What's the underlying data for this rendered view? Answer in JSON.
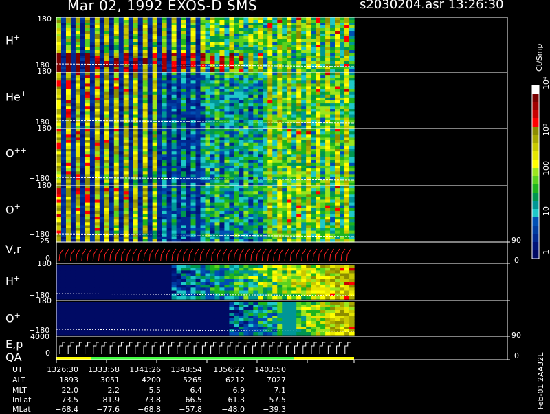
{
  "header": {
    "title": "Mar 02, 1992   EXOS-D SMS",
    "file_time": "s2030204.asr  13:26:30"
  },
  "panels": [
    {
      "label": "H",
      "sup": "+",
      "top": "180",
      "bottom": "−180"
    },
    {
      "label": "He",
      "sup": "+",
      "top": "180",
      "bottom": "−180"
    },
    {
      "label": "O",
      "sup": "++",
      "top": "180",
      "bottom": "−180"
    },
    {
      "label": "O",
      "sup": "+",
      "top": "180",
      "bottom": "−180"
    },
    {
      "label": "V,r",
      "sup": "",
      "top": "25",
      "bottom": "0",
      "right_top": "90",
      "right_bottom": "0"
    },
    {
      "label": "H",
      "sup": "+",
      "top": "180",
      "bottom": "−180"
    },
    {
      "label": "O",
      "sup": "+",
      "top": "180",
      "bottom": "−180",
      "right_bottom": "90"
    },
    {
      "label": "E,p",
      "sup": "",
      "label2": "QA",
      "top": "4000",
      "bottom": "0",
      "right_bottom": "0"
    }
  ],
  "colorbar": {
    "unit": "Ct/Smp",
    "ticks": [
      "10⁴",
      "10³",
      "100",
      "10",
      "1"
    ],
    "colors": [
      "#ffffff",
      "#7a0000",
      "#a00000",
      "#c80000",
      "#ff0000",
      "#8c8c00",
      "#a8a800",
      "#c8c800",
      "#e6e600",
      "#ffff00",
      "#9be61e",
      "#5ad21e",
      "#1eb41e",
      "#009650",
      "#009696",
      "#1ec8c8",
      "#0050b4",
      "#003ca0",
      "#002890",
      "#001478",
      "#000a64"
    ]
  },
  "orbit": {
    "labels": [
      "UT",
      "ALT",
      "MLT",
      "InLat",
      "MLat"
    ],
    "columns": [
      [
        "1326:30",
        "1893",
        "22.0",
        "73.5",
        "−68.4"
      ],
      [
        "1333:58",
        "3051",
        "2.2",
        "81.9",
        "−77.6"
      ],
      [
        "1341:26",
        "4200",
        "5.5",
        "73.8",
        "−68.8"
      ],
      [
        "1348:54",
        "5265",
        "6.4",
        "66.5",
        "−57.8"
      ],
      [
        "1356:22",
        "6212",
        "6.9",
        "61.3",
        "−48.0"
      ],
      [
        "1403:50",
        "7027",
        "7.1",
        "57.5",
        "−39.3"
      ]
    ]
  },
  "footer": {
    "code": "Feb-01 2AA32L"
  },
  "chart_data": {
    "type": "heatmap",
    "title": "Mar 02, 1992   EXOS-D SMS",
    "subtitle": "s2030204.asr  13:26:30",
    "x": [
      "1326:30",
      "1333:58",
      "1341:26",
      "1348:54",
      "1356:22",
      "1403:50"
    ],
    "panels": [
      "H+",
      "He+",
      "O++",
      "O+",
      "V,r",
      "H+",
      "O+",
      "E,p QA"
    ],
    "ylim_pitch": [
      -180,
      180
    ],
    "ylim_vr": [
      0,
      25
    ],
    "ylim_ep": [
      0,
      4000
    ],
    "colorbar_range": [
      1,
      10000
    ],
    "colorbar_scale": "log",
    "colorbar_unit": "Ct/Smp"
  }
}
